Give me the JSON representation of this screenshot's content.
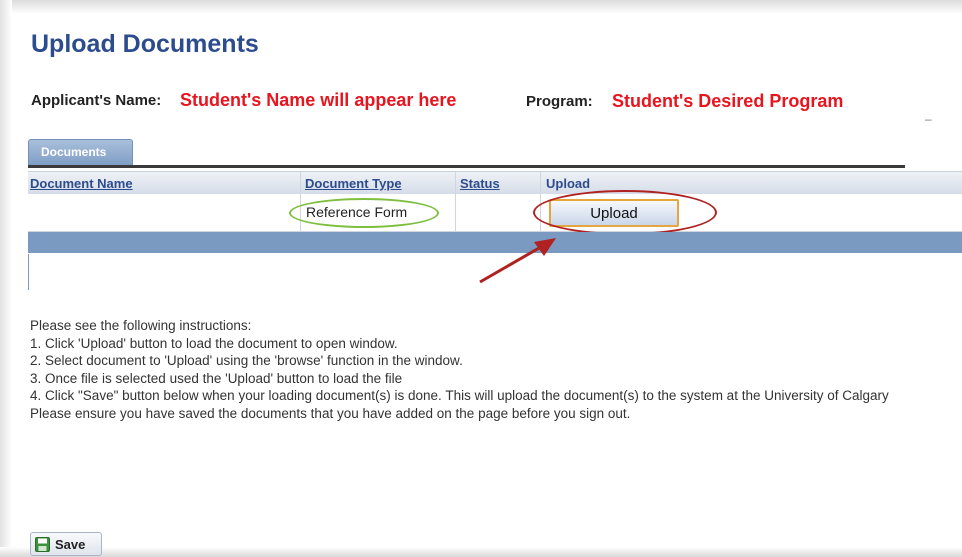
{
  "page": {
    "title": "Upload Documents"
  },
  "applicant": {
    "label": "Applicant's Name:",
    "value": "Student's Name will appear here"
  },
  "program": {
    "label": "Program:",
    "value": "Student's Desired Program"
  },
  "tabs": [
    {
      "label": "Documents",
      "active": true
    }
  ],
  "table": {
    "columns": [
      "Document Name",
      "Document Type",
      "Status",
      "Upload"
    ],
    "rows": [
      {
        "document_name": "",
        "document_type": "Reference Form",
        "status": "",
        "upload_label": "Upload"
      }
    ]
  },
  "instructions": {
    "intro": "Please see the following instructions:",
    "steps": [
      "1. Click 'Upload' button to load the document to open window.",
      "2. Select document to 'Upload' using the 'browse' function in the window.",
      "3. Once file is selected used the 'Upload' button to load the file",
      "4. Click \"Save\" button below when your loading document(s) is done. This will upload the document(s) to the system at the University of Calgary"
    ],
    "note": "Please ensure you have saved the documents that you have added on the page before you sign out."
  },
  "footer": {
    "save_label": "Save",
    "save_icon": "disk-icon"
  },
  "colors": {
    "title": "#2d4c8e",
    "highlight_text": "#e8141e",
    "tab": "#7e9dc4",
    "header_bar": "#7a9ac1",
    "annotation_green": "#7fbf3f",
    "annotation_red": "#b02222"
  }
}
